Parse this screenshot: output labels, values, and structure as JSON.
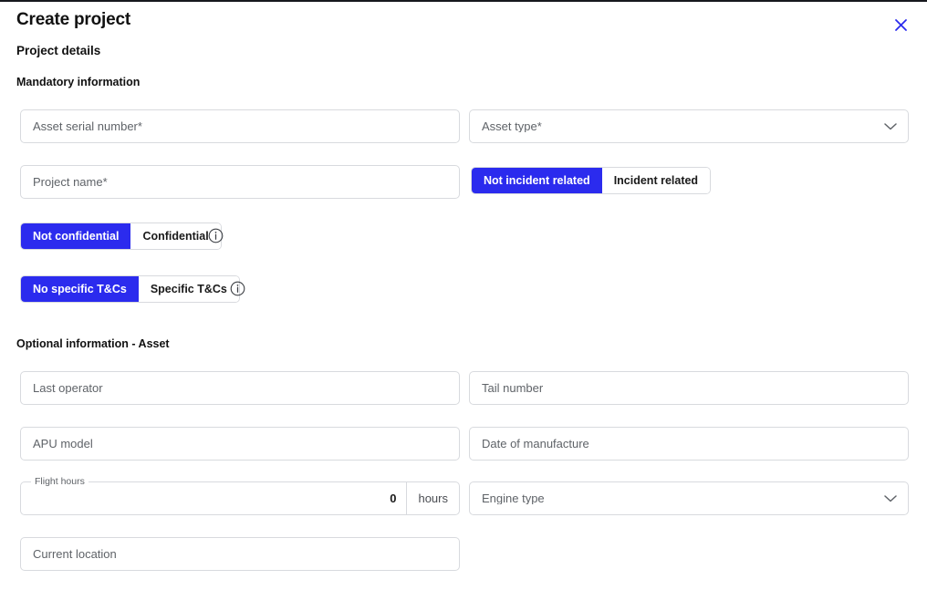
{
  "modal": {
    "title": "Create project",
    "close_label": "close-icon"
  },
  "sections": {
    "project_details": "Project details",
    "mandatory": "Mandatory information",
    "optional_asset": "Optional information - Asset"
  },
  "mandatory_fields": {
    "asset_serial_number": {
      "placeholder": "Asset serial number*",
      "value": ""
    },
    "asset_type": {
      "placeholder": "Asset type*",
      "value": ""
    },
    "project_name": {
      "placeholder": "Project name*",
      "value": ""
    }
  },
  "toggles": {
    "incident": {
      "options": [
        "Not incident related",
        "Incident related"
      ],
      "selected": "Not incident related"
    },
    "confidential": {
      "options": [
        "Not confidential",
        "Confidential"
      ],
      "selected": "Not confidential"
    },
    "tcs": {
      "options": [
        "No specific T&Cs",
        "Specific T&Cs"
      ],
      "selected": "No specific T&Cs"
    }
  },
  "optional_fields": {
    "last_operator": {
      "placeholder": "Last operator",
      "value": ""
    },
    "tail_number": {
      "placeholder": "Tail number",
      "value": ""
    },
    "apu_model": {
      "placeholder": "APU model",
      "value": ""
    },
    "date_of_manufacture": {
      "placeholder": "Date of manufacture",
      "value": ""
    },
    "flight_hours": {
      "label": "Flight hours",
      "value": "0",
      "unit": "hours"
    },
    "engine_type": {
      "placeholder": "Engine type",
      "value": ""
    },
    "current_location": {
      "placeholder": "Current location",
      "value": ""
    }
  },
  "icons": {
    "chevron_down": "chevron-down-icon",
    "info": "info-icon",
    "close": "close-icon"
  },
  "colors": {
    "accent_blue": "#2B2BEE",
    "border_grey": "#d8dade",
    "placeholder_grey": "#5f6368",
    "text_dark": "#111111"
  }
}
